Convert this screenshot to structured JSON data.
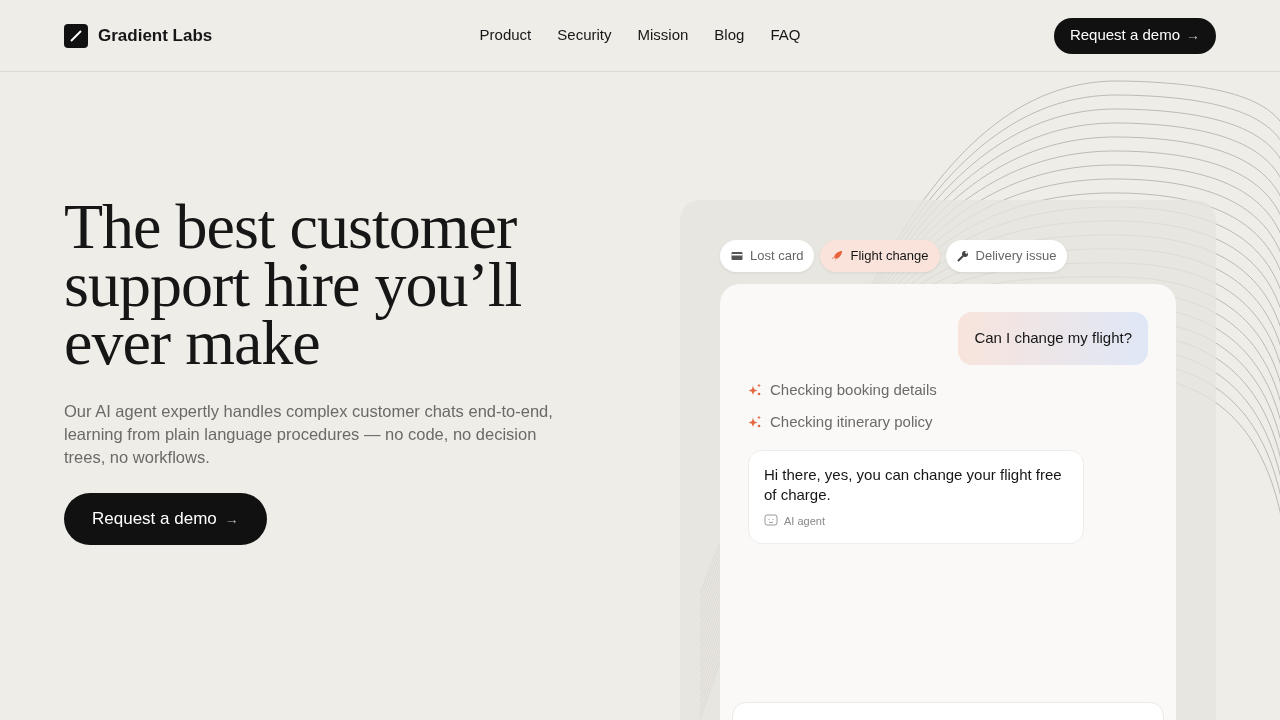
{
  "header": {
    "logo_text": "Gradient Labs",
    "nav": [
      "Product",
      "Security",
      "Mission",
      "Blog",
      "FAQ"
    ],
    "cta": {
      "label": "Request a demo",
      "icon": "→"
    }
  },
  "hero": {
    "headline": "The best customer support hire you’ll ever make",
    "description": "Our AI agent expertly handles complex customer chats end-to-end, learning from plain language procedures — no code, no decision trees, no workflows.",
    "cta": {
      "label": "Request a demo",
      "icon": "→"
    }
  },
  "demo": {
    "tabs": [
      {
        "label": "Lost card",
        "kind": "card",
        "selected": false
      },
      {
        "label": "Flight change",
        "kind": "rocket",
        "selected": true
      },
      {
        "label": "Delivery issue",
        "kind": "wrench",
        "selected": false
      }
    ],
    "customer_message": "Can I change my flight?",
    "steps": [
      "Checking booking details",
      "Checking itinerary policy"
    ],
    "agent_message": {
      "text": "Hi there, yes, you can change your flight free of charge.",
      "sender": "AI agent"
    }
  }
}
